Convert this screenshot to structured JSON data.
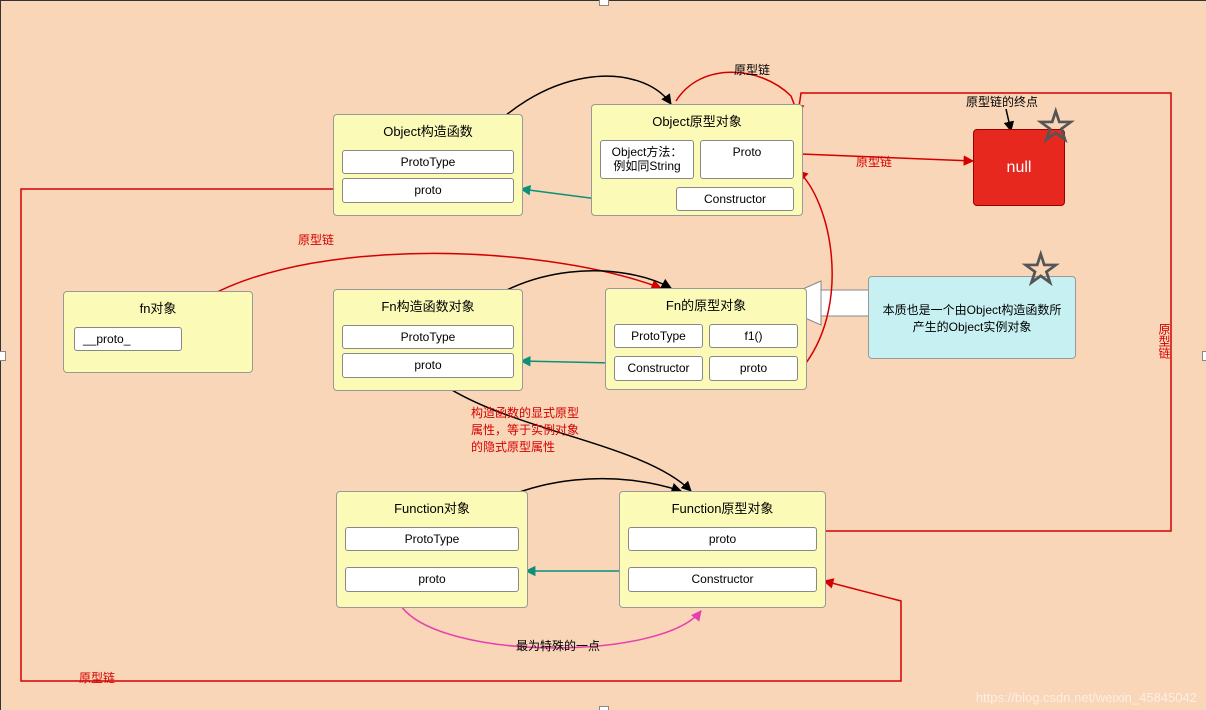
{
  "labels": {
    "proto_chain": "原型链",
    "proto_chain_end": "原型链的终点",
    "null": "null",
    "explicit_note": "构造函数的显式原型\n属性，等于实例对象\n的隐式原型属性",
    "special_note": "最为特殊的一点",
    "essence_note": "本质也是一个由Object构造函数所产生的Object实例对象",
    "watermark": "https://blog.csdn.net/weixin_45845042"
  },
  "boxes": {
    "obj_ctor": {
      "title": "Object构造函数",
      "a": "ProtoType",
      "b": "proto"
    },
    "obj_proto": {
      "title": "Object原型对象",
      "a": "Object方法：例如同String",
      "b": "Proto",
      "c": "Constructor"
    },
    "fn_inst": {
      "title": "fn对象",
      "a": "__proto_"
    },
    "fn_ctor": {
      "title": "Fn构造函数对象",
      "a": "ProtoType",
      "b": "proto"
    },
    "fn_proto": {
      "title": "Fn的原型对象",
      "a": "ProtoType",
      "b": "f1()",
      "c": "Constructor",
      "d": "proto"
    },
    "func_obj": {
      "title": "Function对象",
      "a": "ProtoType",
      "b": "proto"
    },
    "func_proto": {
      "title": "Function原型对象",
      "a": "proto",
      "b": "Constructor"
    }
  }
}
